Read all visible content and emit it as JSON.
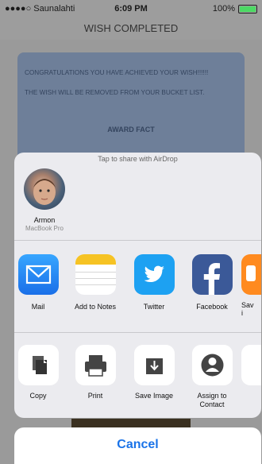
{
  "status": {
    "carrier": "●●●●○ Saunalahti",
    "time": "6:09 PM",
    "battery": "100%"
  },
  "nav": {
    "title": "WISH COMPLETED"
  },
  "message": {
    "line1": "CONGRATULATIONS YOU HAVE ACHIEVED YOUR WISH!!!!!!",
    "line2": "THE WISH WILL BE REMOVED FROM YOUR BUCKET LIST."
  },
  "second_card": {
    "title": "AWARD FACT"
  },
  "sheet": {
    "airdrop_hint": "Tap to share with AirDrop",
    "person": {
      "name": "Armon",
      "device": "MacBook Pro"
    },
    "apps": [
      {
        "label": "Mail",
        "icon": "mail-icon"
      },
      {
        "label": "Add to Notes",
        "icon": "notes-icon"
      },
      {
        "label": "Twitter",
        "icon": "twitter-icon"
      },
      {
        "label": "Facebook",
        "icon": "facebook-icon"
      },
      {
        "label": "Sav\ni",
        "icon": "partial-app-icon"
      }
    ],
    "actions": [
      {
        "label": "Copy",
        "icon": "copy-icon"
      },
      {
        "label": "Print",
        "icon": "print-icon"
      },
      {
        "label": "Save Image",
        "icon": "save-image-icon"
      },
      {
        "label": "Assign to Contact",
        "icon": "contact-icon"
      }
    ],
    "cancel": "Cancel"
  },
  "colors": {
    "mail": "#1a8cf0",
    "twitter": "#1da1f2",
    "facebook": "#3b5998",
    "notes": "#f6c324",
    "cancel": "#1a73e8"
  }
}
